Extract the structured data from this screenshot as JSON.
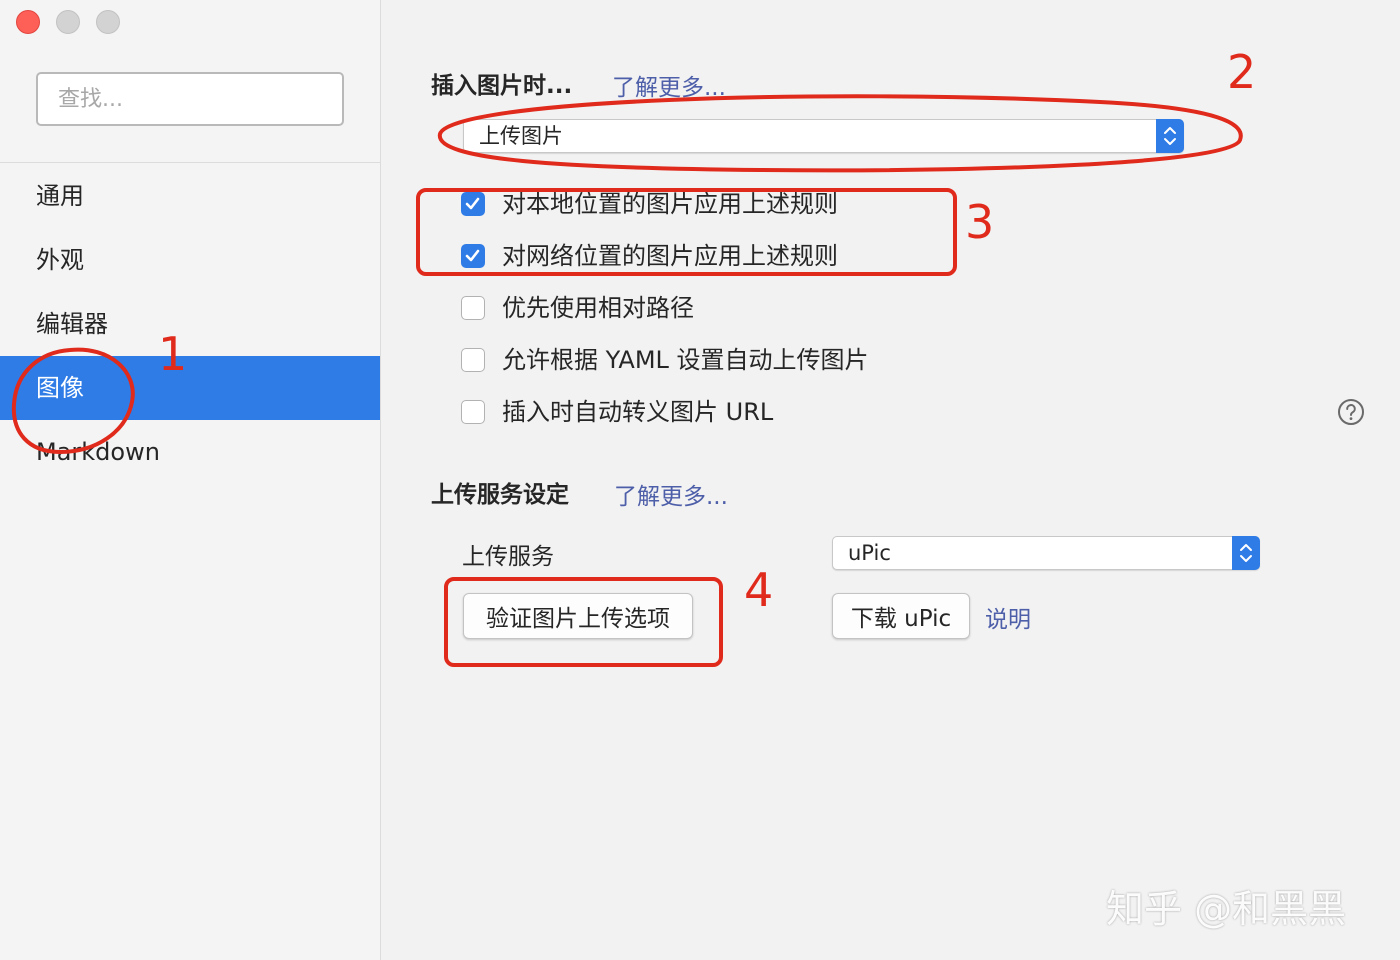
{
  "sidebar": {
    "search_placeholder": "查找...",
    "items": [
      {
        "label": "通用",
        "active": false
      },
      {
        "label": "外观",
        "active": false
      },
      {
        "label": "编辑器",
        "active": false
      },
      {
        "label": "图像",
        "active": true
      },
      {
        "label": "Markdown",
        "active": false
      }
    ]
  },
  "insert_image": {
    "title": "插入图片时...",
    "learn_more": "了解更多...",
    "action_selected": "上传图片",
    "options": [
      {
        "label": "对本地位置的图片应用上述规则",
        "checked": true
      },
      {
        "label": "对网络位置的图片应用上述规则",
        "checked": true
      },
      {
        "label": "优先使用相对路径",
        "checked": false
      },
      {
        "label": "允许根据 YAML 设置自动上传图片",
        "checked": false
      },
      {
        "label": "插入时自动转义图片 URL",
        "checked": false
      }
    ]
  },
  "upload_service": {
    "title": "上传服务设定",
    "learn_more": "了解更多...",
    "service_label": "上传服务",
    "service_selected": "uPic",
    "validate_button": "验证图片上传选项",
    "download_button": "下载 uPic",
    "help_link": "说明"
  },
  "annotations": {
    "color": "#e02a1c",
    "labels": [
      "1",
      "2",
      "3",
      "4"
    ]
  },
  "watermark": "知乎 @和黑黑",
  "colors": {
    "accent": "#2f7ce7",
    "link": "#4e5fa9",
    "annotation": "#e02a1c"
  }
}
